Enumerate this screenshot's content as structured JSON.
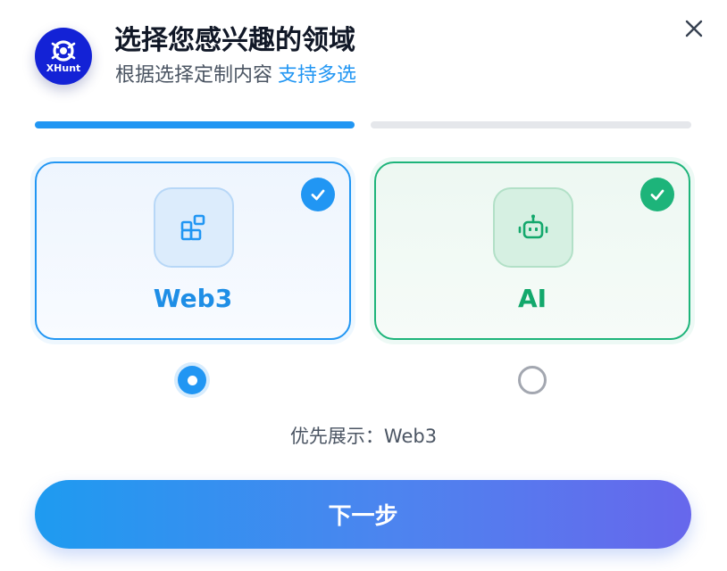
{
  "logo": {
    "text": "XHunt"
  },
  "header": {
    "title": "选择您感兴趣的领域",
    "subtitle": "根据选择定制内容",
    "subtitle_accent": "支持多选"
  },
  "progress": {
    "steps": 2,
    "current": 1
  },
  "options": [
    {
      "label": "Web3",
      "selected": true,
      "priority": true,
      "icon": "blocks-icon",
      "color": "#2196f3"
    },
    {
      "label": "AI",
      "selected": true,
      "priority": false,
      "icon": "robot-icon",
      "color": "#1db47a"
    }
  ],
  "priority": {
    "label": "优先展示：",
    "value": "Web3"
  },
  "next_button": {
    "label": "下一步"
  },
  "colors": {
    "brand": "#1322d6",
    "accent_blue": "#2196f3",
    "accent_green": "#1db47a"
  }
}
